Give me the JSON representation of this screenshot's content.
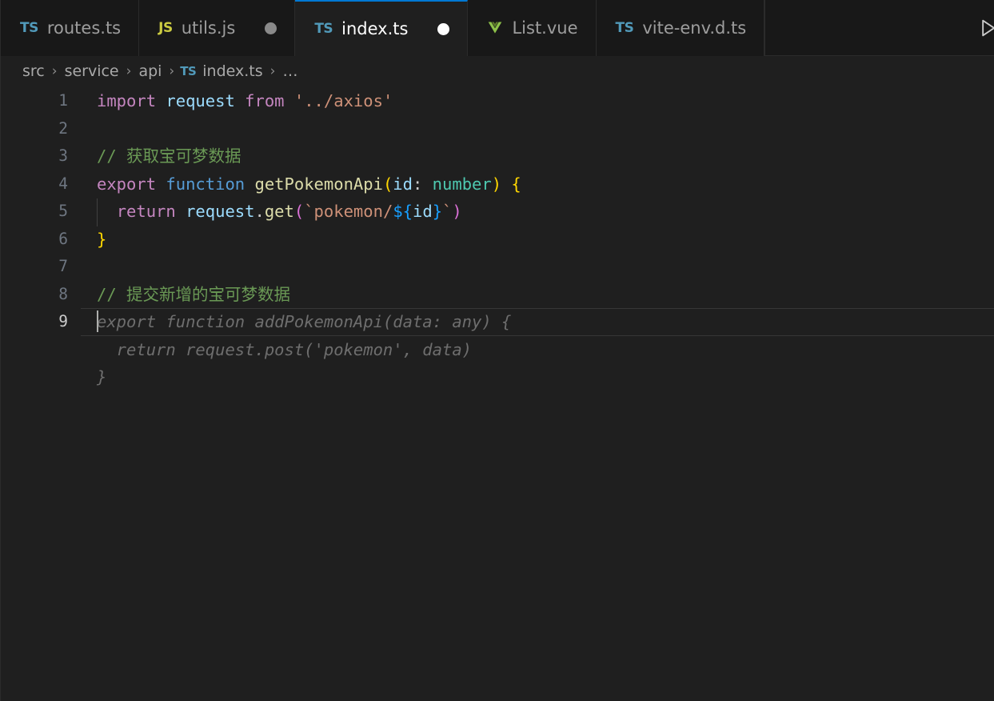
{
  "window": {
    "background": "#1f1f1f",
    "tabbar_background": "#181818",
    "accent": "#0078d4"
  },
  "tabbar": {
    "tabs": [
      {
        "icon": "typescript-file-icon",
        "icon_label": "TS",
        "icon_color": "#519aba",
        "label": "routes.ts",
        "active": false,
        "dirty": false
      },
      {
        "icon": "javascript-file-icon",
        "icon_label": "JS",
        "icon_color": "#cbcb41",
        "label": "utils.js",
        "active": false,
        "dirty": true
      },
      {
        "icon": "typescript-file-icon",
        "icon_label": "TS",
        "icon_color": "#519aba",
        "label": "index.ts",
        "active": true,
        "dirty": true
      },
      {
        "icon": "vue-file-icon",
        "icon_label": "V",
        "icon_color": "#8dc149",
        "label": "List.vue",
        "active": false,
        "dirty": false
      },
      {
        "icon": "typescript-file-icon",
        "icon_label": "TS",
        "icon_color": "#519aba",
        "label": "vite-env.d.ts",
        "active": false,
        "dirty": false
      }
    ],
    "run_button": "run-play-icon"
  },
  "breadcrumb": {
    "separator": "›",
    "items": [
      {
        "label": "src",
        "icon": null
      },
      {
        "label": "service",
        "icon": null
      },
      {
        "label": "api",
        "icon": null
      },
      {
        "label": "index.ts",
        "icon": "TS"
      },
      {
        "label": "…",
        "icon": null
      }
    ]
  },
  "editor": {
    "language": "typescript",
    "cursor_line": 9,
    "cursor_column": 1,
    "line_numbers": [
      "1",
      "2",
      "3",
      "4",
      "5",
      "6",
      "7",
      "8",
      "9"
    ],
    "lines": [
      {
        "n": "1",
        "tokens": [
          {
            "t": "import",
            "c": "t-key"
          },
          {
            "t": " ",
            "c": "t-plain"
          },
          {
            "t": "request",
            "c": "t-var"
          },
          {
            "t": " ",
            "c": "t-plain"
          },
          {
            "t": "from",
            "c": "t-key"
          },
          {
            "t": " ",
            "c": "t-plain"
          },
          {
            "t": "'../axios'",
            "c": "t-str"
          }
        ]
      },
      {
        "n": "2",
        "tokens": []
      },
      {
        "n": "3",
        "tokens": [
          {
            "t": "// 获取宝可梦数据",
            "c": "t-comment"
          }
        ]
      },
      {
        "n": "4",
        "tokens": [
          {
            "t": "export",
            "c": "t-key"
          },
          {
            "t": " ",
            "c": "t-plain"
          },
          {
            "t": "function",
            "c": "t-kw2"
          },
          {
            "t": " ",
            "c": "t-plain"
          },
          {
            "t": "getPokemonApi",
            "c": "t-fn"
          },
          {
            "t": "(",
            "c": "t-b1"
          },
          {
            "t": "id",
            "c": "t-var"
          },
          {
            "t": ":",
            "c": "t-punct"
          },
          {
            "t": " ",
            "c": "t-plain"
          },
          {
            "t": "number",
            "c": "t-type"
          },
          {
            "t": ")",
            "c": "t-b1"
          },
          {
            "t": " ",
            "c": "t-plain"
          },
          {
            "t": "{",
            "c": "t-b1"
          }
        ]
      },
      {
        "n": "5",
        "tokens": [
          {
            "t": "  ",
            "c": "t-plain"
          },
          {
            "t": "return",
            "c": "t-key"
          },
          {
            "t": " ",
            "c": "t-plain"
          },
          {
            "t": "request",
            "c": "t-var"
          },
          {
            "t": ".",
            "c": "t-punct"
          },
          {
            "t": "get",
            "c": "t-fn"
          },
          {
            "t": "(",
            "c": "t-b2"
          },
          {
            "t": "`pokemon/",
            "c": "t-str"
          },
          {
            "t": "${",
            "c": "t-b3"
          },
          {
            "t": "id",
            "c": "t-var"
          },
          {
            "t": "}",
            "c": "t-b3"
          },
          {
            "t": "`",
            "c": "t-str"
          },
          {
            "t": ")",
            "c": "t-b2"
          }
        ]
      },
      {
        "n": "6",
        "tokens": [
          {
            "t": "}",
            "c": "t-b1"
          }
        ]
      },
      {
        "n": "7",
        "tokens": []
      },
      {
        "n": "8",
        "tokens": [
          {
            "t": "// 提交新增的宝可梦数据",
            "c": "t-comment"
          }
        ]
      },
      {
        "n": "9",
        "tokens": [],
        "current": true
      }
    ],
    "inline_suggestion": {
      "type": "ghost-text",
      "color": "#6e6e6e",
      "style": "italic",
      "lines": [
        "export function addPokemonApi(data: any) {",
        "  return request.post('pokemon', data)",
        "}"
      ]
    }
  }
}
